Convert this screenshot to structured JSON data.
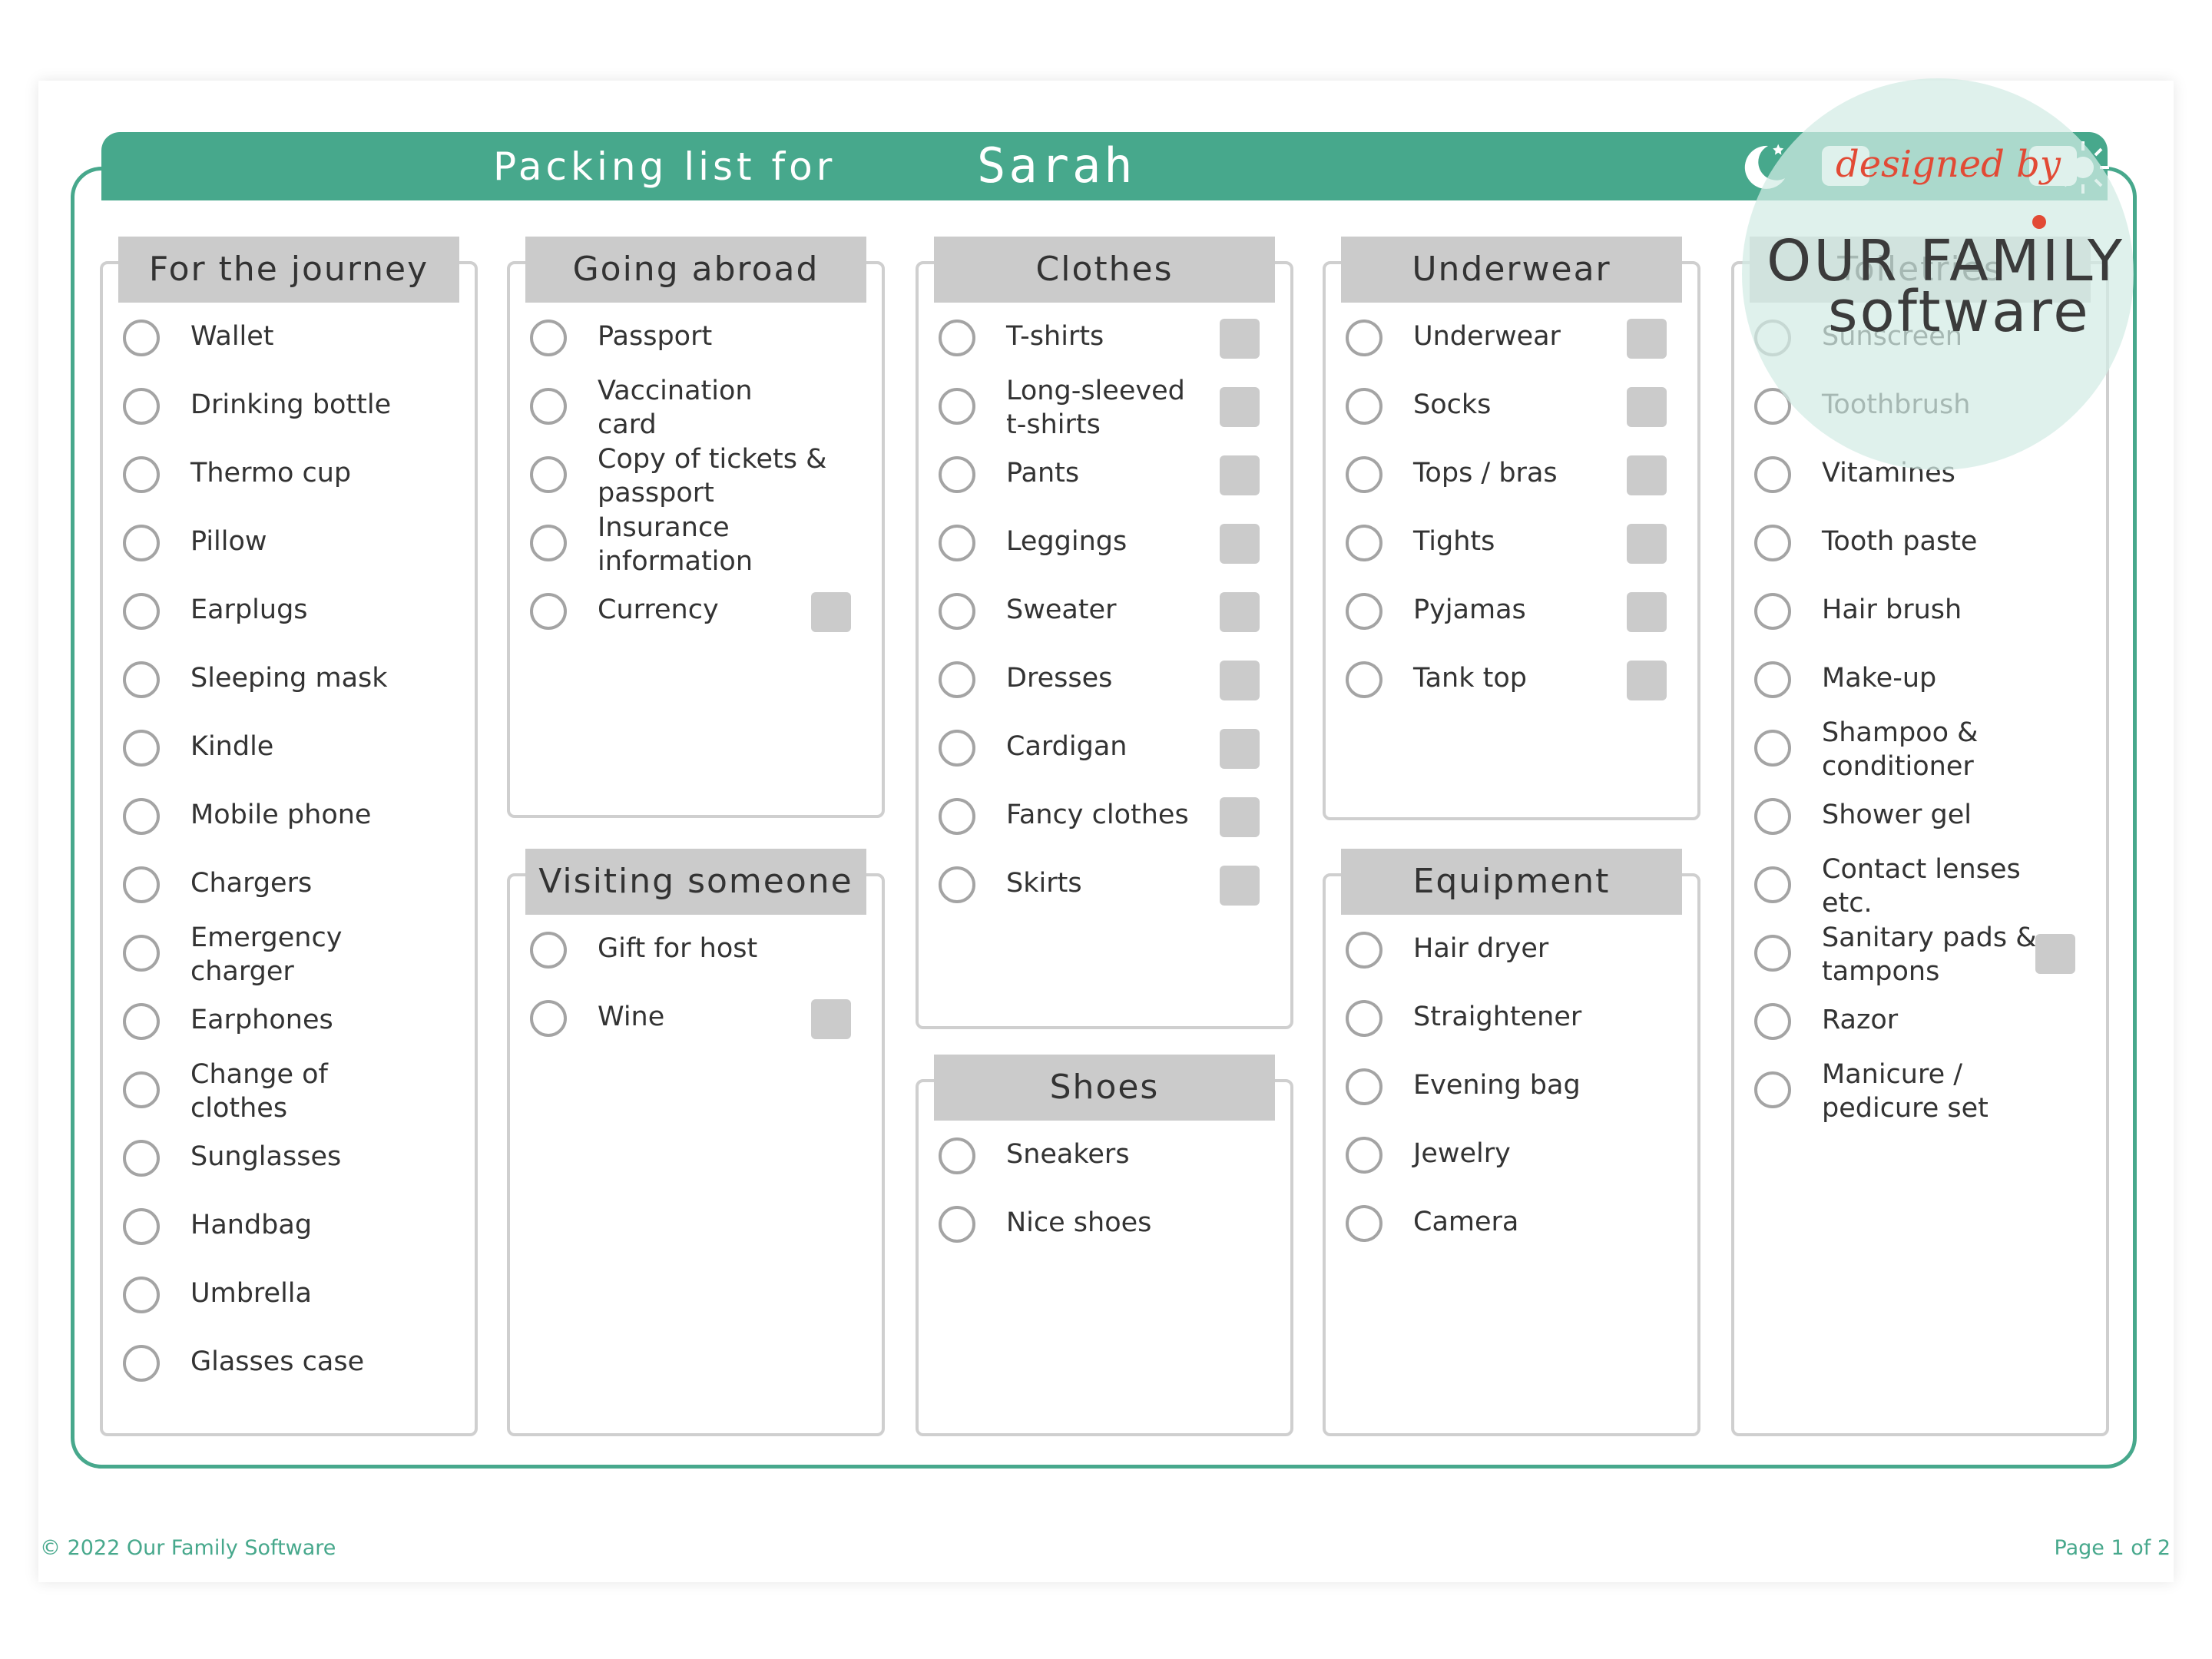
{
  "header": {
    "title": "Packing list for",
    "name": "Sarah"
  },
  "watermark": {
    "designed_by": "designed by",
    "brand_line1": "OUR FAMILY",
    "brand_line2": "software"
  },
  "footer": {
    "copyright": "© 2022 Our Family Software",
    "page": "Page 1 of 2"
  },
  "columns": [
    {
      "sections": [
        {
          "title": "For the journey",
          "items": [
            {
              "label": "Wallet",
              "quantity_box": false
            },
            {
              "label": "Drinking bottle",
              "quantity_box": false
            },
            {
              "label": "Thermo cup",
              "quantity_box": false
            },
            {
              "label": "Pillow",
              "quantity_box": false
            },
            {
              "label": "Earplugs",
              "quantity_box": false
            },
            {
              "label": "Sleeping mask",
              "quantity_box": false
            },
            {
              "label": "Kindle",
              "quantity_box": false
            },
            {
              "label": "Mobile phone",
              "quantity_box": false
            },
            {
              "label": "Chargers",
              "quantity_box": false
            },
            {
              "label": "Emergency\ncharger",
              "quantity_box": false
            },
            {
              "label": "Earphones",
              "quantity_box": false
            },
            {
              "label": "Change of\nclothes",
              "quantity_box": false
            },
            {
              "label": "Sunglasses",
              "quantity_box": false
            },
            {
              "label": "Handbag",
              "quantity_box": false
            },
            {
              "label": "Umbrella",
              "quantity_box": false
            },
            {
              "label": "Glasses case",
              "quantity_box": false
            }
          ]
        }
      ]
    },
    {
      "sections": [
        {
          "title": "Going abroad",
          "items": [
            {
              "label": "Passport",
              "quantity_box": false
            },
            {
              "label": "Vaccination\ncard",
              "quantity_box": false
            },
            {
              "label": "Copy of tickets &\npassport",
              "quantity_box": false
            },
            {
              "label": "Insurance\ninformation",
              "quantity_box": false
            },
            {
              "label": "Currency",
              "quantity_box": true
            }
          ]
        },
        {
          "title": "Visiting someone",
          "items": [
            {
              "label": "Gift for host",
              "quantity_box": false
            },
            {
              "label": "Wine",
              "quantity_box": true
            }
          ]
        }
      ]
    },
    {
      "sections": [
        {
          "title": "Clothes",
          "items": [
            {
              "label": "T-shirts",
              "quantity_box": true
            },
            {
              "label": "Long-sleeved\nt-shirts",
              "quantity_box": true
            },
            {
              "label": "Pants",
              "quantity_box": true
            },
            {
              "label": "Leggings",
              "quantity_box": true
            },
            {
              "label": "Sweater",
              "quantity_box": true
            },
            {
              "label": "Dresses",
              "quantity_box": true
            },
            {
              "label": "Cardigan",
              "quantity_box": true
            },
            {
              "label": "Fancy clothes",
              "quantity_box": true
            },
            {
              "label": "Skirts",
              "quantity_box": true
            }
          ]
        },
        {
          "title": "Shoes",
          "items": [
            {
              "label": "Sneakers",
              "quantity_box": false
            },
            {
              "label": "Nice shoes",
              "quantity_box": false
            }
          ]
        }
      ]
    },
    {
      "sections": [
        {
          "title": "Underwear",
          "items": [
            {
              "label": "Underwear",
              "quantity_box": true
            },
            {
              "label": "Socks",
              "quantity_box": true
            },
            {
              "label": "Tops / bras",
              "quantity_box": true
            },
            {
              "label": "Tights",
              "quantity_box": true
            },
            {
              "label": "Pyjamas",
              "quantity_box": true
            },
            {
              "label": "Tank top",
              "quantity_box": true
            }
          ]
        },
        {
          "title": "Equipment",
          "items": [
            {
              "label": "Hair dryer",
              "quantity_box": false
            },
            {
              "label": "Straightener",
              "quantity_box": false
            },
            {
              "label": "Evening bag",
              "quantity_box": false
            },
            {
              "label": "Jewelry",
              "quantity_box": false
            },
            {
              "label": "Camera",
              "quantity_box": false
            }
          ]
        }
      ]
    },
    {
      "sections": [
        {
          "title": "Toiletries",
          "items": [
            {
              "label": "Sunscreen",
              "quantity_box": false
            },
            {
              "label": "Toothbrush",
              "quantity_box": false
            },
            {
              "label": "Vitamines",
              "quantity_box": false
            },
            {
              "label": "Tooth paste",
              "quantity_box": false
            },
            {
              "label": "Hair brush",
              "quantity_box": false
            },
            {
              "label": "Make-up",
              "quantity_box": false
            },
            {
              "label": "Shampoo &\nconditioner",
              "quantity_box": false
            },
            {
              "label": "Shower gel",
              "quantity_box": false
            },
            {
              "label": "Contact lenses\netc.",
              "quantity_box": false
            },
            {
              "label": "Sanitary pads &\ntampons",
              "quantity_box": true
            },
            {
              "label": "Razor",
              "quantity_box": false
            },
            {
              "label": "Manicure /\npedicure set",
              "quantity_box": false
            }
          ]
        }
      ]
    }
  ],
  "colors": {
    "accent": "#47a88c",
    "header_gray": "#cbcbcb",
    "border_gray": "#cfcfcf",
    "watermark_red": "#e24a35"
  }
}
